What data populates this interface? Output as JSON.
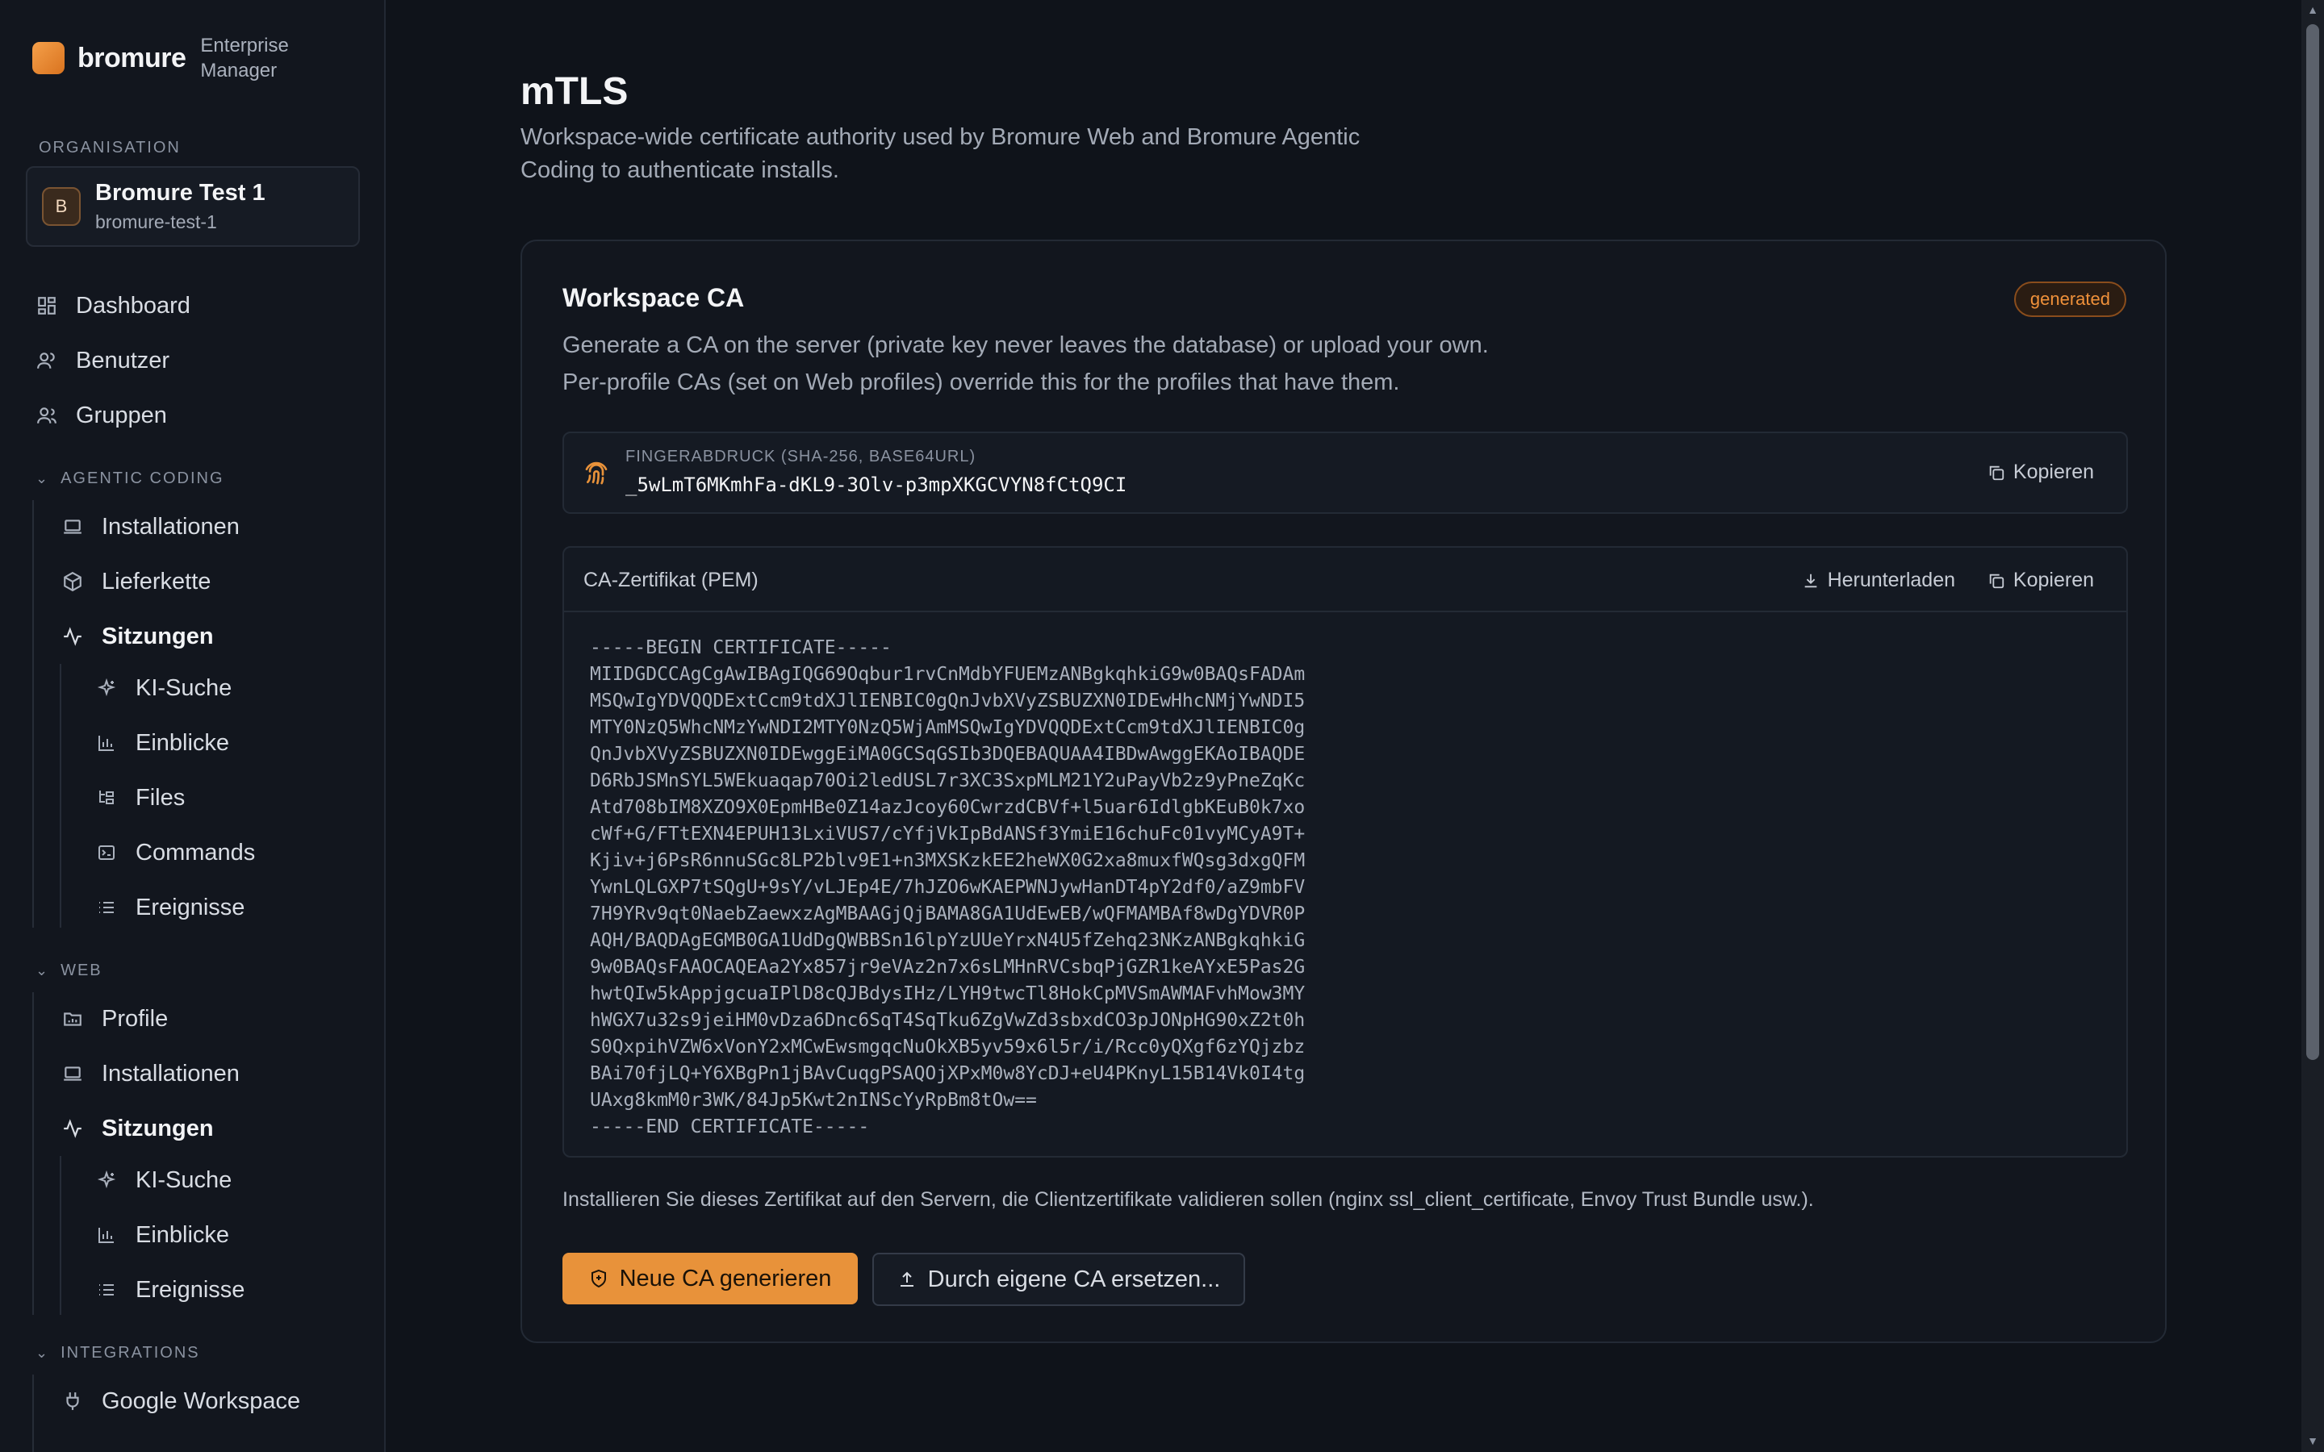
{
  "brand": {
    "name": "bromure",
    "subtitle": "Enterprise Manager"
  },
  "sidebar": {
    "org_label": "ORGANISATION",
    "org": {
      "avatar": "B",
      "name": "Bromure Test 1",
      "slug": "bromure-test-1"
    },
    "top_items": [
      {
        "label": "Dashboard",
        "icon": "dashboard-icon"
      },
      {
        "label": "Benutzer",
        "icon": "user-icon"
      },
      {
        "label": "Gruppen",
        "icon": "users-icon"
      }
    ],
    "agentic": {
      "label": "AGENTIC CODING",
      "items": [
        {
          "label": "Installationen",
          "icon": "laptop-icon"
        },
        {
          "label": "Lieferkette",
          "icon": "package-icon"
        },
        {
          "label": "Sitzungen",
          "icon": "activity-icon"
        }
      ],
      "sub_items": [
        {
          "label": "KI-Suche",
          "icon": "sparkles-icon"
        },
        {
          "label": "Einblicke",
          "icon": "bar-chart-icon"
        },
        {
          "label": "Files",
          "icon": "file-tree-icon"
        },
        {
          "label": "Commands",
          "icon": "terminal-icon"
        },
        {
          "label": "Ereignisse",
          "icon": "list-icon"
        }
      ]
    },
    "web": {
      "label": "WEB",
      "items": [
        {
          "label": "Profile",
          "icon": "folder-icon"
        },
        {
          "label": "Installationen",
          "icon": "laptop-icon"
        },
        {
          "label": "Sitzungen",
          "icon": "activity-icon"
        }
      ],
      "sub_items": [
        {
          "label": "KI-Suche",
          "icon": "sparkles-icon"
        },
        {
          "label": "Einblicke",
          "icon": "bar-chart-icon"
        },
        {
          "label": "Ereignisse",
          "icon": "list-icon"
        }
      ]
    },
    "integrations": {
      "label": "INTEGRATIONS",
      "items": [
        {
          "label": "Google Workspace",
          "icon": "plug-icon"
        }
      ]
    }
  },
  "main": {
    "title": "mTLS",
    "description": "Workspace-wide certificate authority used by Bromure Web and Bromure Agentic Coding to authenticate installs.",
    "card": {
      "title": "Workspace CA",
      "badge": "generated",
      "description": "Generate a CA on the server (private key never leaves the database) or upload your own. Per-profile CAs (set on Web profiles) override this for the profiles that have them.",
      "fingerprint": {
        "label": "FINGERABDRUCK (SHA-256, BASE64URL)",
        "value": "_5wLmT6MKmhFa-dKL9-3Olv-p3mpXKGCVYN8fCtQ9CI",
        "copy_label": "Kopieren"
      },
      "pem": {
        "title": "CA-Zertifikat (PEM)",
        "download_label": "Herunterladen",
        "copy_label": "Kopieren",
        "text": "-----BEGIN CERTIFICATE-----\nMIIDGDCCAgCgAwIBAgIQG69Oqbur1rvCnMdbYFUEMzANBgkqhkiG9w0BAQsFADAm\nMSQwIgYDVQQDExtCcm9tdXJlIENBIC0gQnJvbXVyZSBUZXN0IDEwHhcNMjYwNDI5\nMTY0NzQ5WhcNMzYwNDI2MTY0NzQ5WjAmMSQwIgYDVQQDExtCcm9tdXJlIENBIC0g\nQnJvbXVyZSBUZXN0IDEwggEiMA0GCSqGSIb3DQEBAQUAA4IBDwAwggEKAoIBAQDE\nD6RbJSMnSYL5WEkuaqap70Oi2ledUSL7r3XC3SxpMLM21Y2uPayVb2z9yPneZqKc\nAtd708bIM8XZO9X0EpmHBe0Z14azJcoy60CwrzdCBVf+l5uar6IdlgbKEuB0k7xo\ncWf+G/FTtEXN4EPUH13LxiVUS7/cYfjVkIpBdANSf3YmiE16chuFc01vyMCyA9T+\nKjiv+j6PsR6nnuSGc8LP2blv9E1+n3MXSKzkEE2heWX0G2xa8muxfWQsg3dxgQFM\nYwnLQLGXP7tSQgU+9sY/vLJEp4E/7hJZO6wKAEPWNJywHanDT4pY2df0/aZ9mbFV\n7H9YRv9qt0NaebZaewxzAgMBAAGjQjBAMA8GA1UdEwEB/wQFMAMBAf8wDgYDVR0P\nAQH/BAQDAgEGMB0GA1UdDgQWBBSn16lpYzUUeYrxN4U5fZehq23NKzANBgkqhkiG\n9w0BAQsFAAOCAQEAa2Yx857jr9eVAz2n7x6sLMHnRVCsbqPjGZR1keAYxE5Pas2G\nhwtQIw5kAppjgcuaIPlD8cQJBdysIHz/LYH9twcTl8HokCpMVSmAWMAFvhMow3MY\nhWGX7u32s9jeiHM0vDza6Dnc6SqT4SqTku6ZgVwZd3sbxdCO3pJONpHG90xZ2t0h\nS0QxpihVZW6xVonY2xMCwEwsmgqcNuOkXB5yv59x6l5r/i/Rcc0yQXgf6zYQjzbz\nBAi70fjLQ+Y6XBgPn1jBAvCuqgPSAQOjXPxM0w8YcDJ+eU4PKnyL15B14Vk0I4tg\nUAxg8kmM0r3WK/84Jp5Kwt2nINScYyRpBm8tOw==\n-----END CERTIFICATE-----"
      },
      "note": "Installieren Sie dieses Zertifikat auf den Servern, die Clientzertifikate validieren sollen (nginx ssl_client_certificate, Envoy Trust Bundle usw.).",
      "primary_button": "Neue CA generieren",
      "secondary_button": "Durch eigene CA ersetzen..."
    }
  },
  "colors": {
    "accent": "#e8923a",
    "background": "#0f131a",
    "sidebar": "#12161e"
  }
}
